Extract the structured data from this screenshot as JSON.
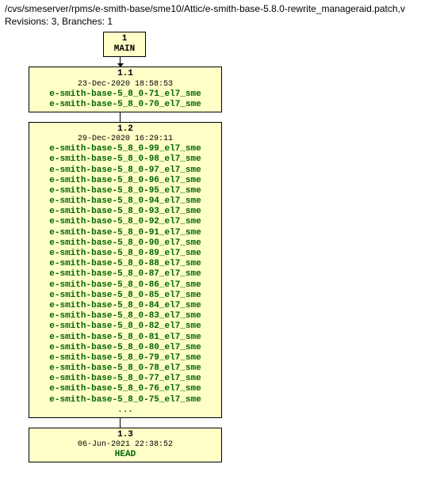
{
  "header": {
    "path": "/cvs/smeserver/rpms/e-smith-base/sme10/Attic/e-smith-base-5.8.0-rewrite_manageraid.patch,v",
    "meta": "Revisions: 3, Branches: 1"
  },
  "nodes": {
    "main": {
      "num": "1",
      "name": "MAIN"
    },
    "rev11": {
      "num": "1.1",
      "date": "23-Dec-2020 18:58:53",
      "tags": [
        "e-smith-base-5_8_0-71_el7_sme",
        "e-smith-base-5_8_0-70_el7_sme"
      ]
    },
    "rev12": {
      "num": "1.2",
      "date": "29-Dec-2020 16:29:11",
      "tags": [
        "e-smith-base-5_8_0-99_el7_sme",
        "e-smith-base-5_8_0-98_el7_sme",
        "e-smith-base-5_8_0-97_el7_sme",
        "e-smith-base-5_8_0-96_el7_sme",
        "e-smith-base-5_8_0-95_el7_sme",
        "e-smith-base-5_8_0-94_el7_sme",
        "e-smith-base-5_8_0-93_el7_sme",
        "e-smith-base-5_8_0-92_el7_sme",
        "e-smith-base-5_8_0-91_el7_sme",
        "e-smith-base-5_8_0-90_el7_sme",
        "e-smith-base-5_8_0-89_el7_sme",
        "e-smith-base-5_8_0-88_el7_sme",
        "e-smith-base-5_8_0-87_el7_sme",
        "e-smith-base-5_8_0-86_el7_sme",
        "e-smith-base-5_8_0-85_el7_sme",
        "e-smith-base-5_8_0-84_el7_sme",
        "e-smith-base-5_8_0-83_el7_sme",
        "e-smith-base-5_8_0-82_el7_sme",
        "e-smith-base-5_8_0-81_el7_sme",
        "e-smith-base-5_8_0-80_el7_sme",
        "e-smith-base-5_8_0-79_el7_sme",
        "e-smith-base-5_8_0-78_el7_sme",
        "e-smith-base-5_8_0-77_el7_sme",
        "e-smith-base-5_8_0-76_el7_sme",
        "e-smith-base-5_8_0-75_el7_sme"
      ],
      "ellipsis": "..."
    },
    "rev13": {
      "num": "1.3",
      "date": "06-Jun-2021 22:38:52",
      "tags": [
        "HEAD"
      ]
    }
  }
}
